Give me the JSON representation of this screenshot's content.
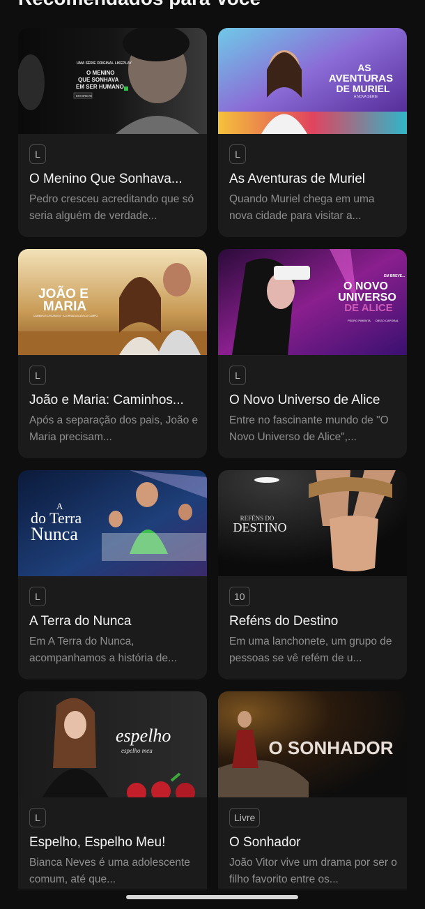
{
  "section": {
    "title": "Recomendados para Você"
  },
  "cards": [
    {
      "rating": "L",
      "title": "O Menino Que Sonhava...",
      "description": "Pedro cresceu acreditando que só seria alguém de verdade...",
      "thumb": {
        "kicker": "UMA SÉRIE ORIGINAL LIKEPLAY",
        "line1": "O MENINO",
        "line2": "QUE SONHAVA",
        "line3": "EM SER HUMANO",
        "tag": "EM BREVE"
      }
    },
    {
      "rating": "L",
      "title": "As Aventuras de Muriel",
      "description": "Quando Muriel chega em uma nova cidade para visitar a...",
      "thumb": {
        "line1": "AS",
        "line2": "AVENTURAS",
        "line3": "DE MURIEL",
        "sub": "A NOVA SÉRIE"
      }
    },
    {
      "rating": "L",
      "title": "João e Maria: Caminhos...",
      "description": "Após a separação dos pais, João e Maria precisam...",
      "thumb": {
        "line1": "JOÃO E",
        "line2": "MARIA",
        "sub": "CAMINHOS CRUZADOS · A JORNADA ALÉM DO CAMPO"
      }
    },
    {
      "rating": "L",
      "title": "O Novo Universo de Alice",
      "description": "Entre no fascinante mundo de \"O Novo Universo de Alice\",...",
      "thumb": {
        "kicker": "EM BREVE...",
        "line1": "O NOVO",
        "line2": "UNIVERSO",
        "line3": "DE ALICE",
        "credit1": "PEDRO PIMENTA",
        "credit2": "DIEGO CAPORAL"
      }
    },
    {
      "rating": "L",
      "title": "A Terra do Nunca",
      "description": "Em A Terra do Nunca, acompanhamos a história de...",
      "thumb": {
        "line1": "A",
        "line2": "do Terra",
        "line3": "Nunca"
      }
    },
    {
      "rating": "10",
      "title": "Reféns do Destino",
      "description": "Em uma lanchonete, um grupo de pessoas se vê refém de u...",
      "thumb": {
        "line1": "REFÉNS DO",
        "line2": "DESTINO"
      }
    },
    {
      "rating": "L",
      "title": "Espelho, Espelho Meu!",
      "description": "Bianca Neves é uma adolescente comum, até que...",
      "thumb": {
        "line1": "espelho",
        "line2": "espelho meu"
      }
    },
    {
      "rating": "Livre",
      "title": "O Sonhador",
      "description": "João Vitor vive um drama por ser o filho favorito entre os...",
      "thumb": {
        "line1": "O SONHADOR"
      }
    }
  ],
  "colors": {
    "background": "#0e0e0e",
    "card": "#1b1b1b",
    "title": "#f3f3f3",
    "description": "#8f8f8f"
  }
}
